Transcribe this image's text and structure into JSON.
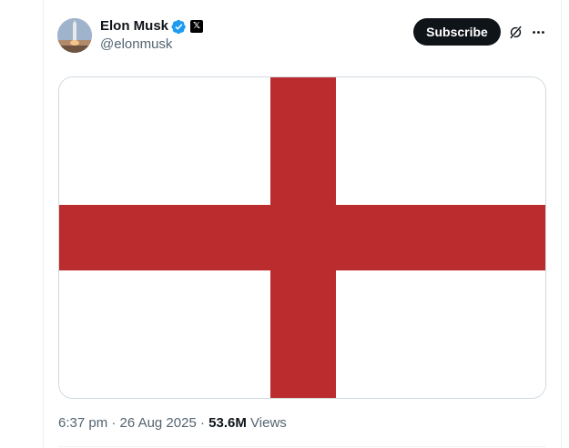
{
  "post": {
    "author": {
      "display_name": "Elon Musk",
      "handle": "@elonmusk",
      "verified_icon": "verified-badge-icon",
      "affiliation_icon": "x-logo-icon",
      "affiliation_letter": "𝕏"
    },
    "subscribe_label": "Subscribe",
    "grok_icon": "grok-icon",
    "more_icon": "more-options-icon",
    "media": {
      "type": "flag",
      "colors": {
        "field": "#ffffff",
        "cross": "#bb2c2f"
      }
    },
    "meta": {
      "time": "6:37 pm",
      "separator": "·",
      "date": "26 Aug 2025",
      "views_count": "53.6M",
      "views_label": "Views"
    }
  },
  "colors": {
    "text_primary": "#0f1419",
    "text_secondary": "#536471",
    "verified_blue": "#1d9bf0",
    "border": "#cfd9de"
  }
}
